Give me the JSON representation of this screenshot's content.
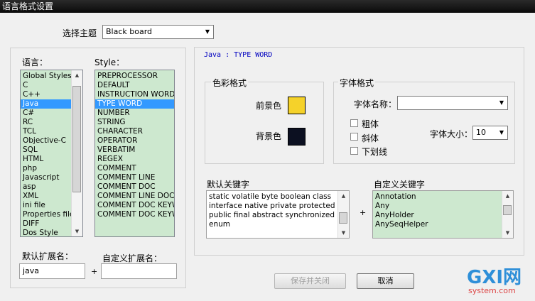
{
  "window": {
    "title": "语言格式设置"
  },
  "theme": {
    "label": "选择主题",
    "selected": "Black board"
  },
  "languages": {
    "header": "语言：",
    "items": [
      "Global Styles",
      "C",
      "C++",
      "Java",
      "C#",
      "RC",
      "TCL",
      "Objective-C",
      "SQL",
      "HTML",
      "php",
      "Javascript",
      "asp",
      "XML",
      "ini file",
      "Properties file",
      "DIFF",
      "Dos Style"
    ],
    "selected_index": 3
  },
  "styles": {
    "header": "Style：",
    "items": [
      "PREPROCESSOR",
      "DEFAULT",
      "INSTRUCTION WORD",
      "TYPE WORD",
      "NUMBER",
      "STRING",
      "CHARACTER",
      "OPERATOR",
      "VERBATIM",
      "REGEX",
      "COMMENT",
      "COMMENT LINE",
      "COMMENT DOC",
      "COMMENT LINE DOC",
      "COMMENT DOC KEYWORD",
      "COMMENT DOC KEYWORD"
    ],
    "selected_index": 3
  },
  "extensions": {
    "default_label": "默认扩展名：",
    "default_value": "java",
    "plus": "+",
    "custom_label": "自定义扩展名：",
    "custom_value": ""
  },
  "style_header": "Java : TYPE WORD",
  "color_format": {
    "title": "色彩格式",
    "fg_label": "前景色",
    "fg_color": "#f5d22a",
    "bg_label": "背景色",
    "bg_color": "#0c1021"
  },
  "font_format": {
    "title": "字体格式",
    "name_label": "字体名称：",
    "name_value": "",
    "bold": "粗体",
    "italic": "斜体",
    "underline": "下划线",
    "size_label": "字体大小：",
    "size_value": "10"
  },
  "default_keywords": {
    "title": "默认关键字",
    "lines": [
      "static volatile byte boolean class",
      "interface native private protected",
      "public final abstract synchronized",
      "enum"
    ]
  },
  "plus": "+",
  "custom_keywords": {
    "title": "自定义关键字",
    "lines": [
      "Annotation",
      "Any",
      "AnyHolder",
      "AnySeqHelper"
    ]
  },
  "buttons": {
    "save_close": "保存并关闭",
    "cancel": "取消"
  },
  "watermark": {
    "logo": "GXI网",
    "site": "system.com"
  }
}
